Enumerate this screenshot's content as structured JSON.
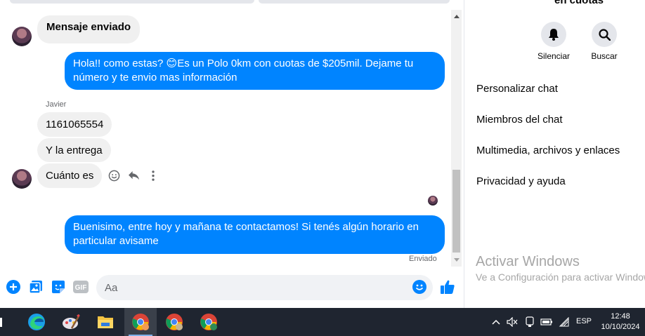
{
  "chat": {
    "messages": {
      "msg1": "Mensaje enviado",
      "msg2": "Hola!! como estas? 😊Es un Polo 0km con cuotas de $205mil. Dejame tu número y te envio mas información",
      "sender": "Javier",
      "msg3": "1161065554",
      "msg4": "Y la entrega",
      "msg5": "Cuánto es",
      "msg6": "Buenisimo, entre hoy y mañana te contactamos! Si tenés algún horario en particular avisame",
      "status": "Enviado"
    },
    "composer": {
      "placeholder": "Aa"
    }
  },
  "info": {
    "title": "en cuotas",
    "actions": {
      "mute": "Silenciar",
      "search": "Buscar"
    },
    "menu": {
      "customize": "Personalizar chat",
      "members": "Miembros del chat",
      "media": "Multimedia, archivos y enlaces",
      "privacy": "Privacidad y ayuda"
    },
    "watermark": {
      "line1": "Activar Windows",
      "line2": "Ve a Configuración para activar Windows."
    }
  },
  "taskbar": {
    "language": "ESP",
    "time": "12:48",
    "date": "10/10/2024"
  },
  "colors": {
    "accent": "#0084ff",
    "bubble_in": "#f0f0f0",
    "taskbar": "#1f2530"
  }
}
